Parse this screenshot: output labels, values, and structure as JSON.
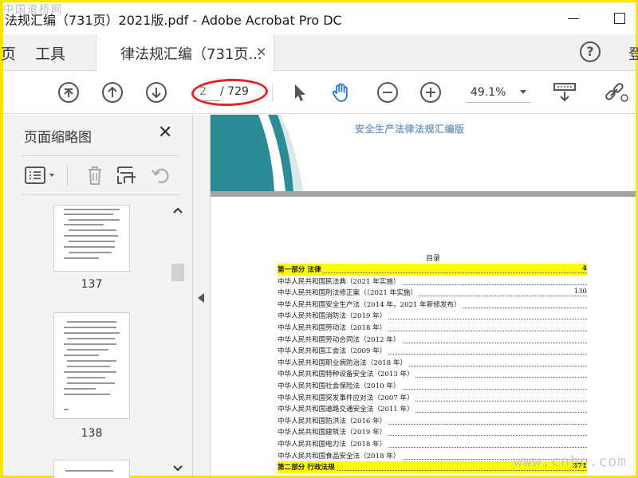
{
  "window": {
    "title": "法规汇编（731页）2021版.pdf - Adobe Acrobat Pro DC",
    "watermark": "中国道桥网"
  },
  "tabs": {
    "partial_left": "页",
    "tools": "工具",
    "document": "律法规汇编（731页...",
    "close_glyph": "×",
    "help_glyph": "?",
    "partial_right": "登"
  },
  "toolbar": {
    "current_page": "2",
    "total_pages": "/ 729",
    "zoom": "49.1%"
  },
  "side_panel": {
    "title": "页面缩略图",
    "close_glyph": "✕",
    "thumbnails": [
      {
        "number": "137"
      },
      {
        "number": "138"
      }
    ]
  },
  "document": {
    "cover_title": "安全生产法律法规汇编版",
    "toc_heading": "目录",
    "toc": [
      {
        "text": "第一部分  法律",
        "page": "4",
        "highlight": true
      },
      {
        "text": "中华人民共和国民法典（2021 年实施）",
        "page": "",
        "highlight": false
      },
      {
        "text": "中华人民共和国刑法修正案（（2021 年实施）",
        "page": "130",
        "highlight": false
      },
      {
        "text": "中华人民共和国安全生产法（2014 年，2021 年新修发布）",
        "page": "",
        "highlight": false
      },
      {
        "text": "中华人民共和国消防法（2019 年）",
        "page": "",
        "highlight": false
      },
      {
        "text": "中华人民共和国劳动法（2018 年）",
        "page": "",
        "highlight": false
      },
      {
        "text": "中华人民共和国劳动合同法（2012 年）",
        "page": "",
        "highlight": false
      },
      {
        "text": "中华人民共和国工会法（2009 年）",
        "page": "",
        "highlight": false
      },
      {
        "text": "中华人民共和国职业病防治法（2018 年）",
        "page": "",
        "highlight": false
      },
      {
        "text": "中华人民共和国特种设备安全法（2013 年）",
        "page": "",
        "highlight": false
      },
      {
        "text": "中华人民共和国社会保险法（2010 年）",
        "page": "",
        "highlight": false
      },
      {
        "text": "中华人民共和国突发事件应对法（2007 年）",
        "page": "",
        "highlight": false
      },
      {
        "text": "中华人民共和国道路交通安全法（2011 年）",
        "page": "",
        "highlight": false
      },
      {
        "text": "中华人民共和国防洪法（2016 年）",
        "page": "",
        "highlight": false
      },
      {
        "text": "中华人民共和国建筑法（2019 年）",
        "page": "",
        "highlight": false
      },
      {
        "text": "中华人民共和国电力法（2018 年）",
        "page": "",
        "highlight": false
      },
      {
        "text": "中华人民共和国食品安全法（2018 年）",
        "page": "",
        "highlight": false
      },
      {
        "text": "第二部分  行政法规",
        "page": "371",
        "highlight": true
      }
    ],
    "watermark": "www.cnbo.com"
  },
  "colors": {
    "border": "#f5e600",
    "accent_blue": "#2a76c6",
    "annotation_red": "#e8202a",
    "teal": "#2b8c96",
    "highlight": "#ffff00"
  }
}
